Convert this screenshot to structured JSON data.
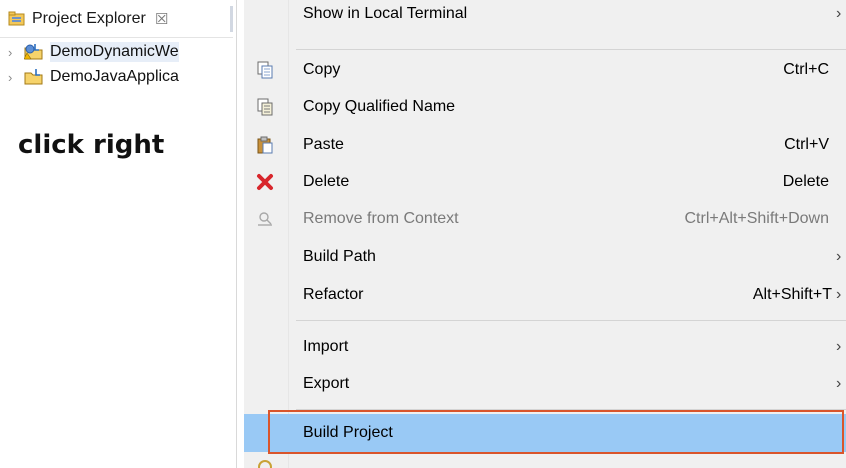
{
  "explorer": {
    "tab_label": "Project Explorer",
    "tab_close_glyph": "☒",
    "tree": [
      {
        "label": "DemoDynamicWe",
        "icon": "dynamic-web-project-icon",
        "chevron": "›"
      },
      {
        "label": "DemoJavaApplica",
        "icon": "java-project-icon",
        "chevron": "›"
      }
    ]
  },
  "annotation": "click right",
  "menu": {
    "items": [
      {
        "label": "Show in Local Terminal",
        "accelerator": "",
        "submenu": true,
        "icon": ""
      },
      {
        "label": "Copy",
        "accelerator": "Ctrl+C",
        "submenu": false,
        "icon": "copy-icon"
      },
      {
        "label": "Copy Qualified Name",
        "accelerator": "",
        "submenu": false,
        "icon": "copy-qualified-name-icon"
      },
      {
        "label": "Paste",
        "accelerator": "Ctrl+V",
        "submenu": false,
        "icon": "paste-icon"
      },
      {
        "label": "Delete",
        "accelerator": "Delete",
        "submenu": false,
        "icon": "delete-icon"
      },
      {
        "label": "Remove from Context",
        "accelerator": "Ctrl+Alt+Shift+Down",
        "submenu": false,
        "icon": "remove-from-context-icon",
        "disabled": true
      },
      {
        "label": "Build Path",
        "accelerator": "",
        "submenu": true,
        "icon": ""
      },
      {
        "label": "Refactor",
        "accelerator": "Alt+Shift+T",
        "submenu": true,
        "icon": ""
      },
      {
        "label": "Import",
        "accelerator": "",
        "submenu": true,
        "icon": ""
      },
      {
        "label": "Export",
        "accelerator": "",
        "submenu": true,
        "icon": ""
      },
      {
        "label": "Build Project",
        "accelerator": "",
        "submenu": false,
        "icon": "",
        "highlighted": true
      }
    ],
    "submenu_arrow": "›"
  },
  "colors": {
    "highlight": "#99c9f5",
    "highlight_border": "#d9552c",
    "menu_bg": "#f0f0f0",
    "delete_red": "#d8262c"
  }
}
